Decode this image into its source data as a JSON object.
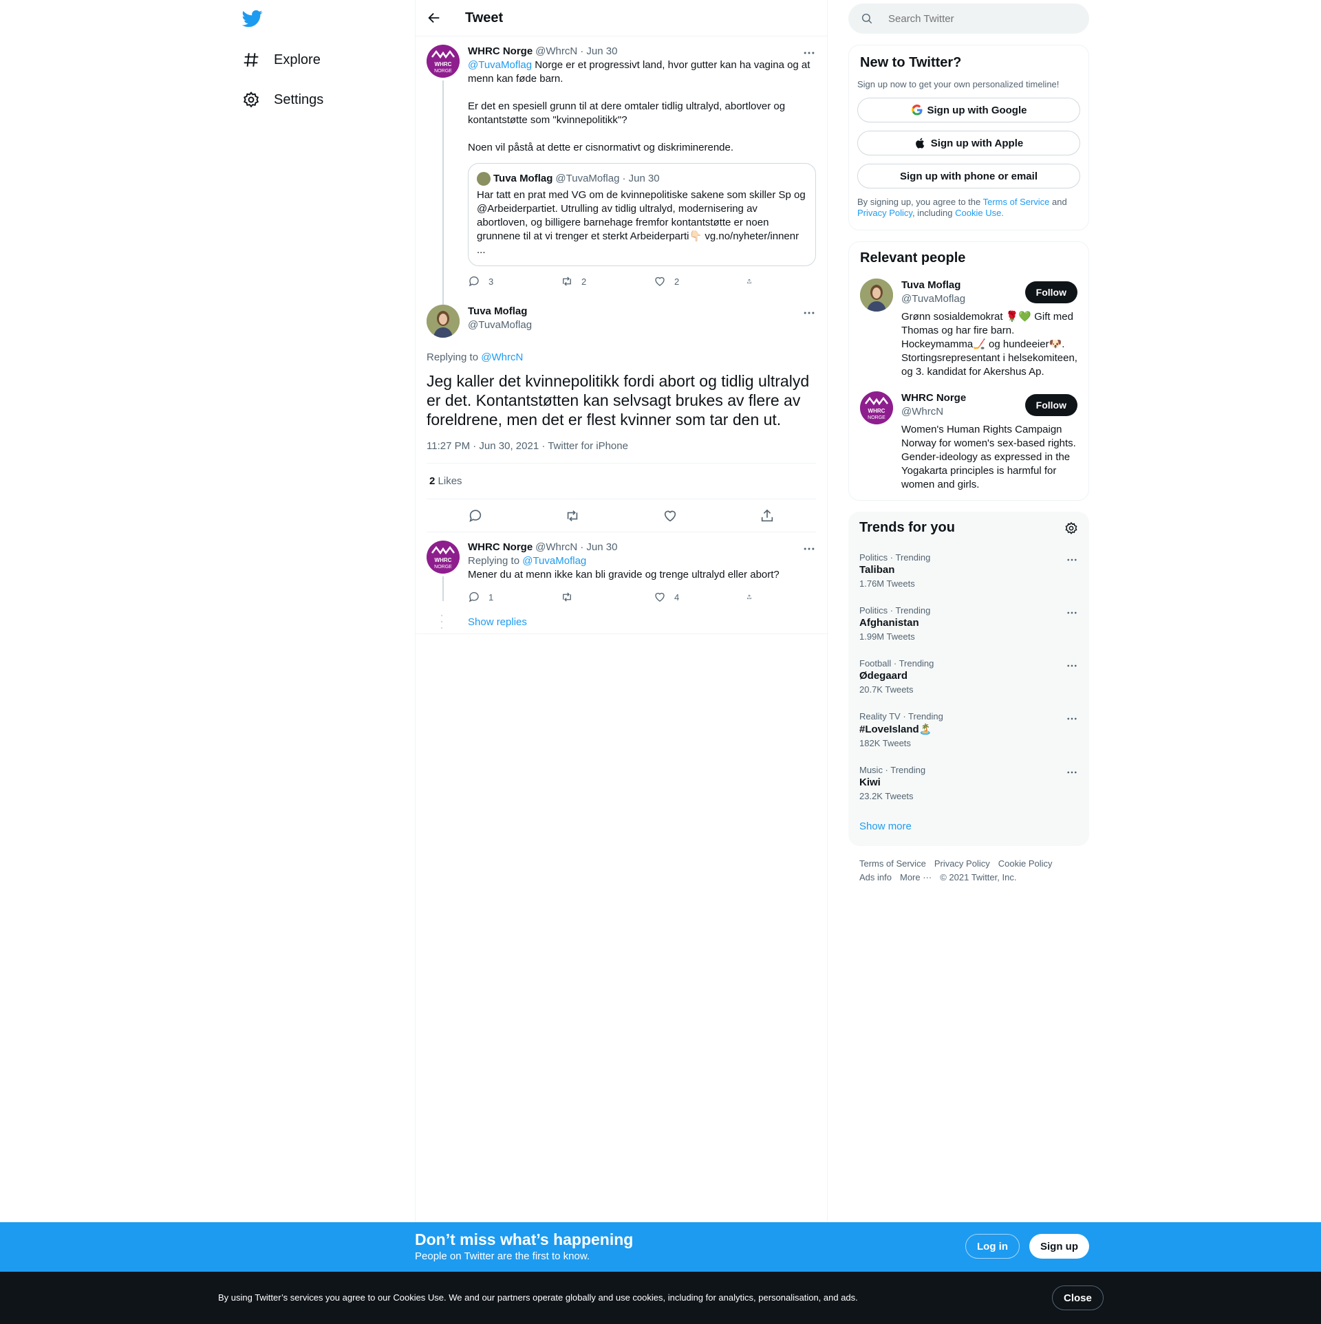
{
  "nav": {
    "explore_label": "Explore",
    "settings_label": "Settings"
  },
  "header": {
    "title": "Tweet"
  },
  "parent_tweet": {
    "name": "WHRC Norge",
    "handle": "@WhrcN",
    "date": "· Jun 30",
    "mention": "@TuvaMoflag",
    "text_1": " Norge er et progressivt land, hvor gutter kan ha vagina og at menn kan føde barn.",
    "text_2": "Er det en spesiell grunn til at dere omtaler tidlig ultralyd, abortlover og kontantstøtte som \"kvinnepolitikk\"?",
    "text_3": "Noen vil påstå at dette er cisnormativt og diskriminerende.",
    "quote": {
      "name": "Tuva Moflag",
      "handle": "@TuvaMoflag",
      "date": "· Jun 30",
      "text": "Har tatt en prat med VG om de kvinnepolitiske sakene som skiller Sp og @Arbeiderpartiet. Utrulling av tidlig ultralyd, modernisering av abortloven, og billigere barnehage fremfor kontantstøtte er noen grunnene til at vi trenger et sterkt Arbeiderparti👇🏻 vg.no/nyheter/innenr",
      "ellipsis": "..."
    },
    "replies": "3",
    "retweets": "2",
    "likes": "2"
  },
  "focus_tweet": {
    "name": "Tuva Moflag",
    "handle": "@TuvaMoflag",
    "replying_prefix": "Replying to ",
    "replying_to": "@WhrcN",
    "text": "Jeg kaller det kvinnepolitikk fordi abort og tidlig ultralyd er det. Kontantstøtten kan selvsagt brukes av flere av foreldrene, men det er flest kvinner som tar den ut.",
    "meta": "11:27 PM · Jun 30, 2021 · Twitter for iPhone",
    "likes_count": "2",
    "likes_label": "Likes"
  },
  "reply_tweet": {
    "name": "WHRC Norge",
    "handle": "@WhrcN",
    "date": "· Jun 30",
    "replying_prefix": "Replying to ",
    "replying_to": "@TuvaMoflag",
    "text": "Mener du at menn ikke kan bli gravide og trenge ultralyd eller abort?",
    "replies": "1",
    "retweets": "",
    "likes": "4",
    "show_replies": "Show replies"
  },
  "search": {
    "placeholder": "Search Twitter"
  },
  "signup_card": {
    "title": "New to Twitter?",
    "subtitle": "Sign up now to get your own personalized timeline!",
    "google": "Sign up with Google",
    "apple": "Sign up with Apple",
    "phone": "Sign up with phone or email",
    "legal_1": "By signing up, you agree to the ",
    "tos": "Terms of Service",
    "legal_2": " and ",
    "privacy": "Privacy Policy",
    "legal_3": ", including ",
    "cookie": "Cookie Use."
  },
  "relevant_people": {
    "title": "Relevant people",
    "follow_label": "Follow",
    "people": [
      {
        "name": "Tuva Moflag",
        "handle": "@TuvaMoflag",
        "bio": "Grønn sosialdemokrat 🌹💚 Gift med Thomas og har fire barn. Hockeymamma🏒 og hundeeier🐶. Stortingsrepresentant i helsekomiteen, og 3. kandidat for Akershus Ap."
      },
      {
        "name": "WHRC Norge",
        "handle": "@WhrcN",
        "bio": "Women's Human Rights Campaign Norway for women's sex-based rights. Gender-ideology as expressed in the Yogakarta principles is harmful for women and girls."
      }
    ]
  },
  "trends": {
    "title": "Trends for you",
    "items": [
      {
        "category": "Politics · Trending",
        "name": "Taliban",
        "count": "1.76M Tweets"
      },
      {
        "category": "Politics · Trending",
        "name": "Afghanistan",
        "count": "1.99M Tweets"
      },
      {
        "category": "Football · Trending",
        "name": "Ødegaard",
        "count": "20.7K Tweets"
      },
      {
        "category": "Reality TV · Trending",
        "name": "#LoveIsland🏝️",
        "count": "182K Tweets"
      },
      {
        "category": "Music · Trending",
        "name": "Kiwi",
        "count": "23.2K Tweets"
      }
    ],
    "show_more": "Show more"
  },
  "footer": {
    "tos": "Terms of Service",
    "privacy": "Privacy Policy",
    "cookie": "Cookie Policy",
    "ads": "Ads info",
    "more": "More ···",
    "copyright": "© 2021 Twitter, Inc."
  },
  "banner": {
    "headline": "Don’t miss what’s happening",
    "subline": "People on Twitter are the first to know.",
    "login": "Log in",
    "signup": "Sign up"
  },
  "cookie_bar": {
    "text": "By using Twitter’s services you agree to our Cookies Use. We and our partners operate globally and use cookies, including for analytics, personalisation, and ads.",
    "close": "Close"
  },
  "avatar_text": {
    "whrc_1": "WHRC",
    "whrc_2": "NORGE"
  },
  "colors": {
    "accent": "#1d9bf0",
    "text": "#0f1419",
    "muted": "#536471",
    "whrc_purple": "#8e1e8e"
  }
}
